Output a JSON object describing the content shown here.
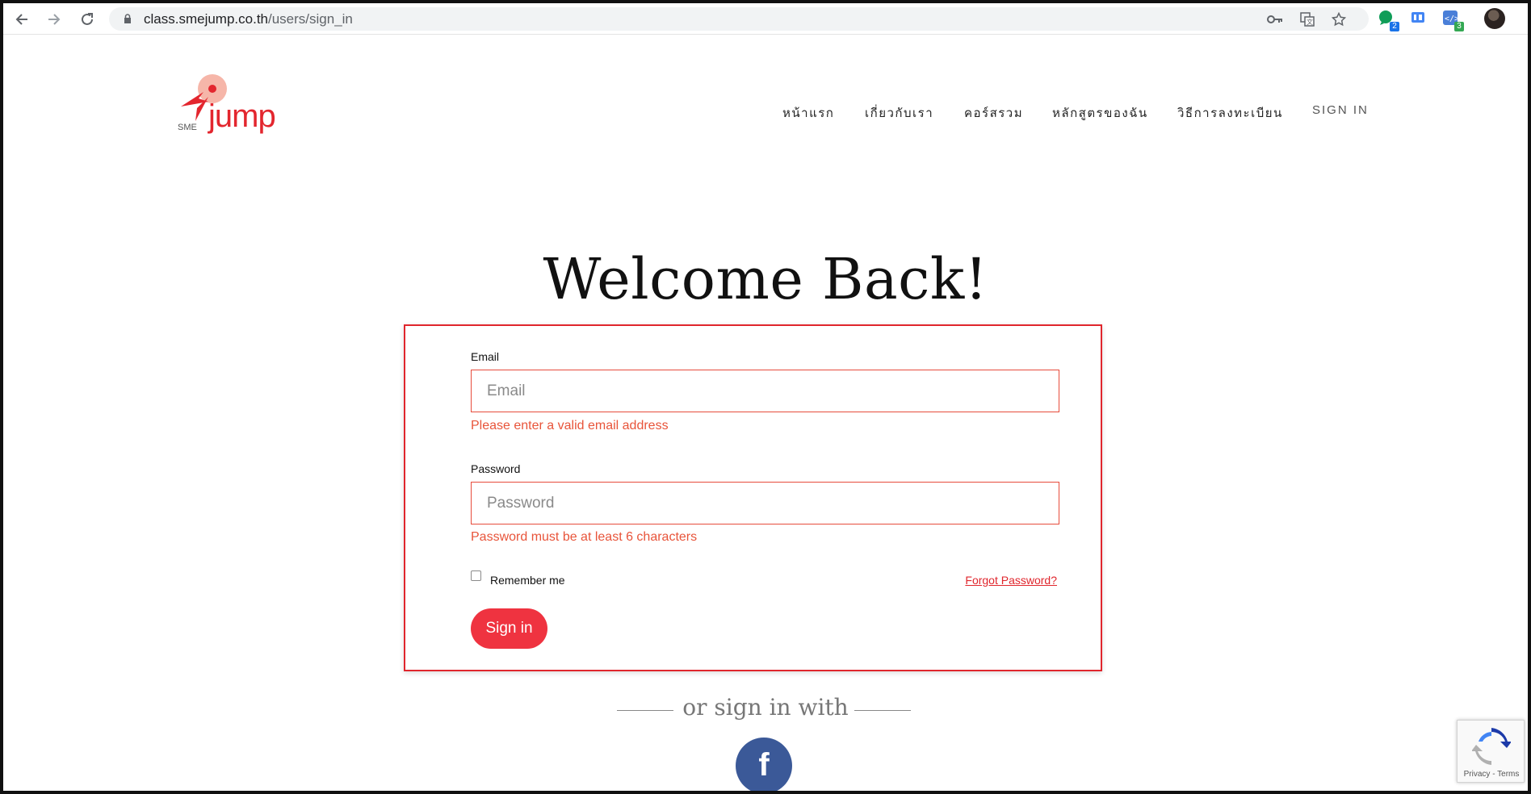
{
  "browser": {
    "url_domain": "class.smejump.co.th",
    "url_path": "/users/sign_in",
    "extension_badges": [
      "2",
      "3"
    ]
  },
  "logo": {
    "small_text": "SME",
    "brand_text": "jump"
  },
  "nav": {
    "items": [
      "หน้าแรก",
      "เกี่ยวกับเรา",
      "คอร์สรวม",
      "หลักสูตรของฉัน",
      "วิธีการลงทะเบียน",
      "SIGN IN"
    ]
  },
  "page": {
    "heading": "Welcome Back!"
  },
  "form": {
    "email_label": "Email",
    "email_placeholder": "Email",
    "email_value": "",
    "email_error": "Please enter a valid email address",
    "password_label": "Password",
    "password_placeholder": "Password",
    "password_value": "",
    "password_error": "Password must be at least 6 characters",
    "remember_label": "Remember me",
    "remember_checked": false,
    "forgot_label": "Forgot Password?",
    "submit_label": "Sign in"
  },
  "social": {
    "divider_text": "or sign in with",
    "facebook_glyph": "f"
  },
  "recaptcha": {
    "links": "Privacy - Terms"
  },
  "colors": {
    "accent": "#ef3340",
    "error": "#e8543a",
    "facebook": "#3b5998"
  }
}
